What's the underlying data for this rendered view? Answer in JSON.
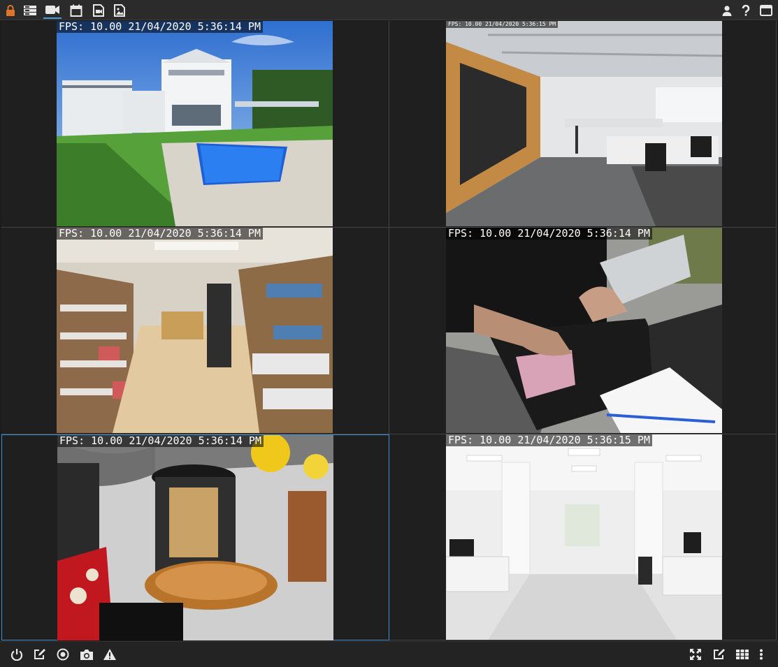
{
  "colors": {
    "toolbar_bg": "#2b2b2b",
    "grid_bg": "#1f1f1f",
    "accent": "#4a9fe0",
    "lock": "#e0752a",
    "icon": "#e8e8e8"
  },
  "toolbar": {
    "left_icons": [
      "lock-icon",
      "server-list-icon",
      "video-camera-icon",
      "calendar-icon",
      "recordings-icon",
      "image-icon"
    ],
    "active": "video-camera-icon",
    "right_icons": [
      "user-icon",
      "help-icon",
      "window-icon"
    ]
  },
  "cameras": [
    {
      "overlay": "FPS: 10.00 21/04/2020 5:36:14 PM",
      "scene": "house-pool"
    },
    {
      "overlay": "FPS: 10.00 21/04/2020 5:36:15 PM",
      "scene": "office-open"
    },
    {
      "overlay": "FPS: 10.00 21/04/2020 5:36:14 PM",
      "scene": "store-shelves"
    },
    {
      "overlay": "FPS: 10.00 21/04/2020 5:36:14 PM",
      "scene": "cash-register"
    },
    {
      "overlay": "FPS: 10.00 21/04/2020 5:36:14 PM",
      "scene": "lobby-lounge"
    },
    {
      "overlay": "FPS: 10.00 21/04/2020 5:36:15 PM",
      "scene": "white-office"
    }
  ],
  "selected_camera": 4,
  "bottombar": {
    "left_icons": [
      "power-icon",
      "edit-icon",
      "record-icon",
      "camera-snapshot-icon",
      "warning-icon"
    ],
    "right_icons": [
      "fullscreen-icon",
      "edit-layout-icon",
      "grid-layout-icon",
      "more-vertical-icon"
    ]
  }
}
